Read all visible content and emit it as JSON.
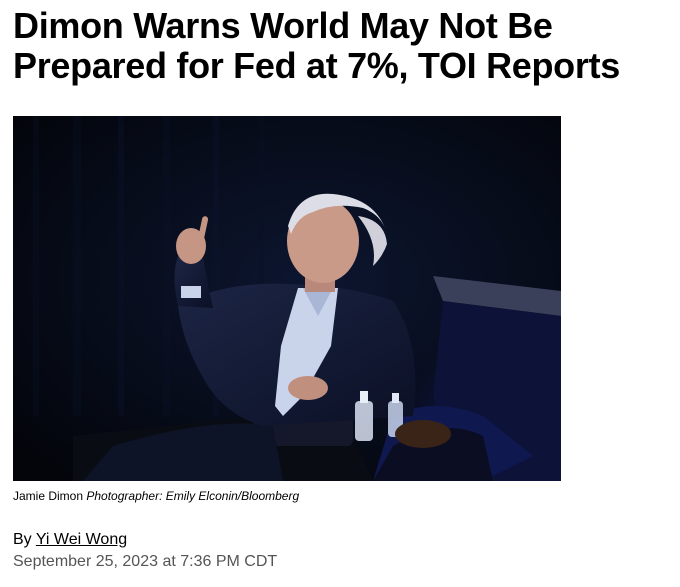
{
  "article": {
    "headline_line1": "Dimon Warns World May Not Be",
    "headline_line2": "Prepared for Fed at 7%, TOI Reports",
    "photo": {
      "caption_subject": "Jamie Dimon",
      "caption_credit": "Photographer: Emily Elconin/Bloomberg"
    },
    "byline_prefix": "By",
    "author": "Yi Wei Wong",
    "timestamp": "September 25, 2023 at 7:36 PM CDT"
  },
  "colors": {
    "text": "#000000",
    "muted_text": "#555555",
    "photo_background": "#04060d",
    "stage_light": "#1a2a8a"
  }
}
